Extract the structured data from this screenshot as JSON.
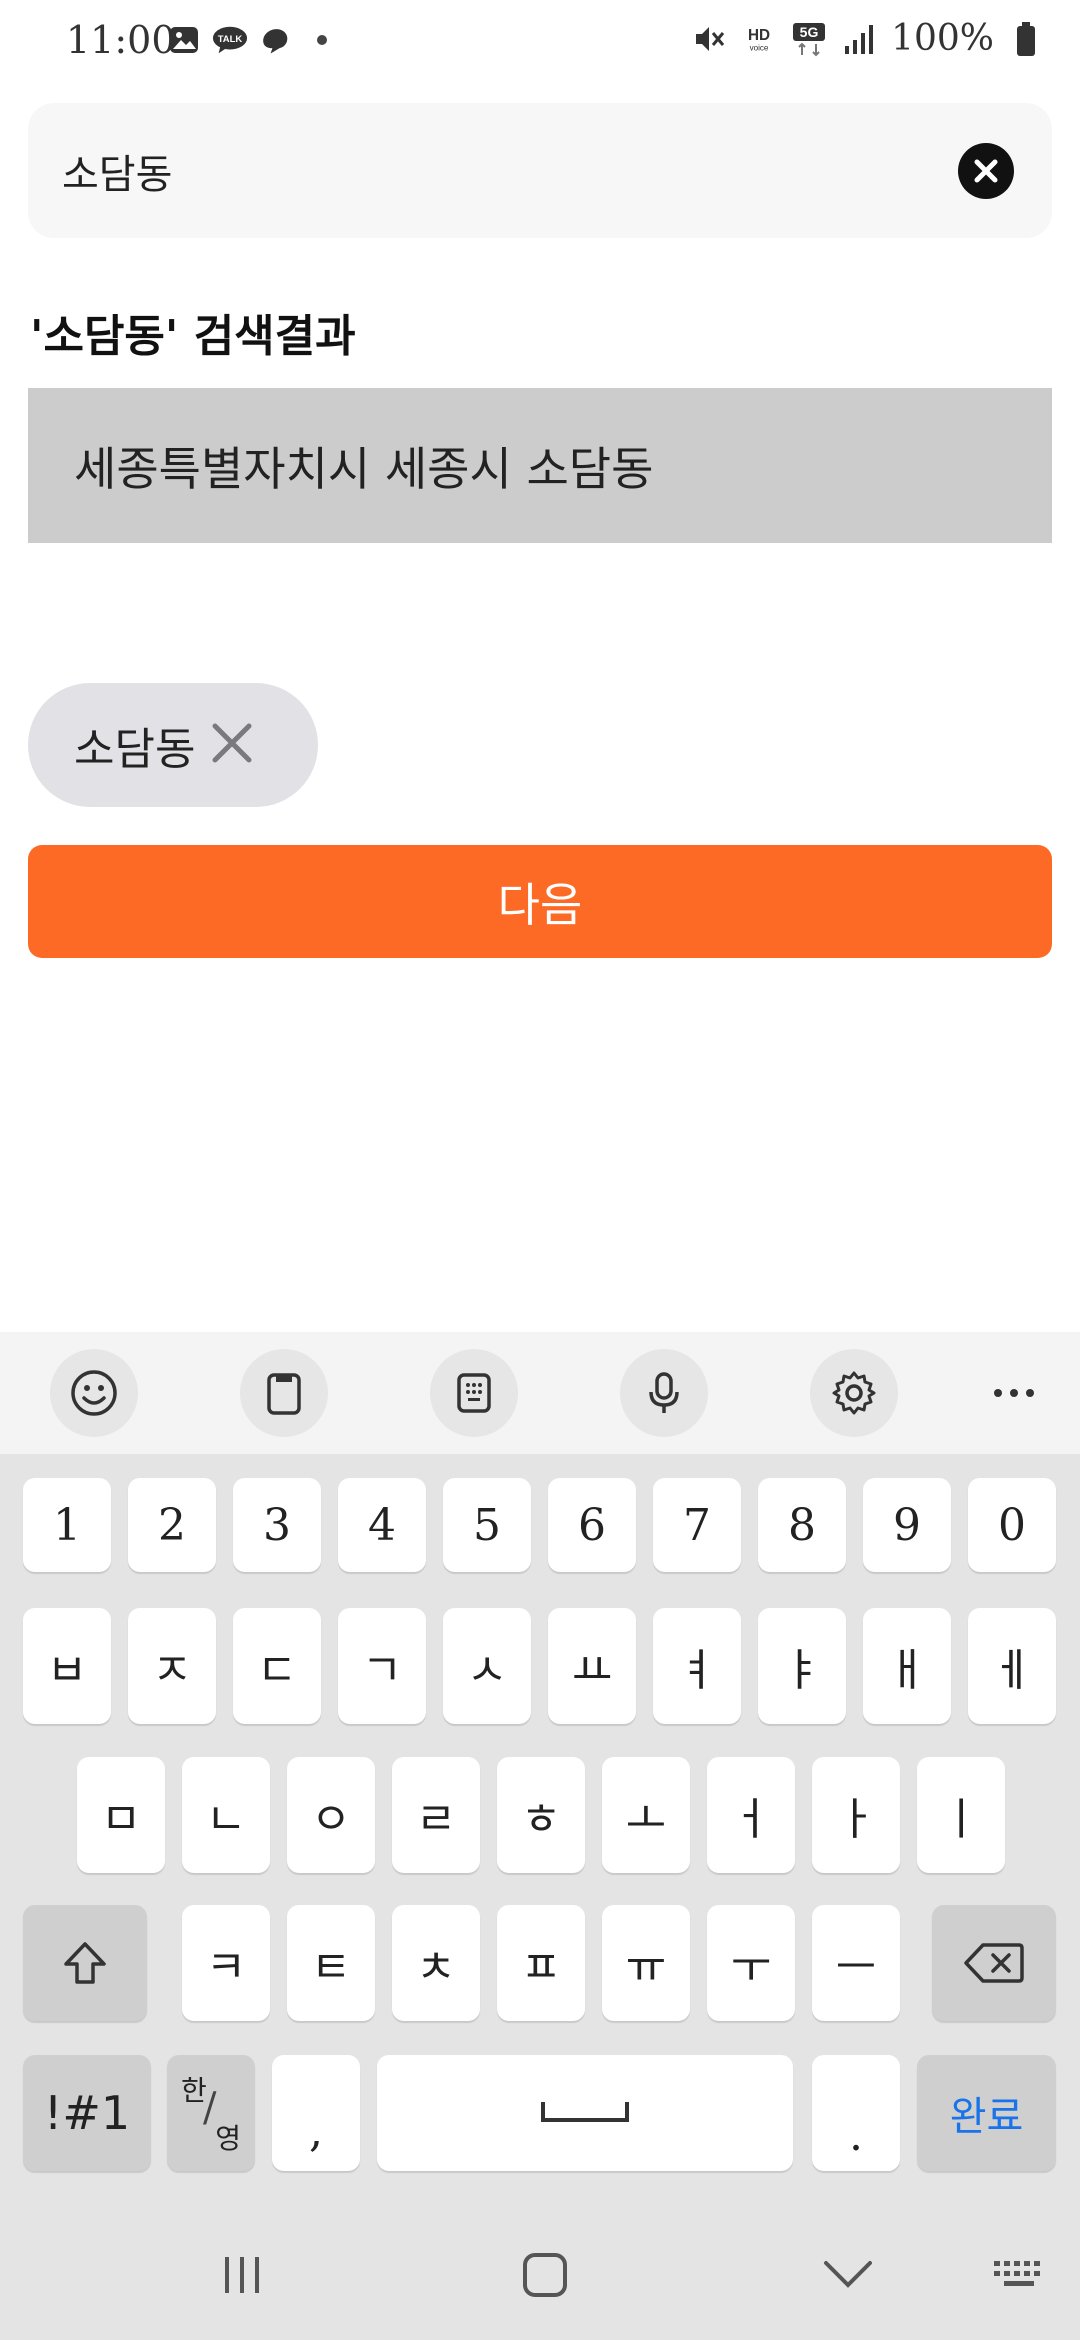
{
  "status_bar": {
    "time": "11:00",
    "left_icons": [
      "gallery-icon",
      "talk-icon",
      "thread-icon",
      "dot-icon"
    ],
    "right_icons": [
      "mute-icon",
      "hd-voice-icon",
      "5g-icon",
      "signal-icon"
    ],
    "battery": "100%"
  },
  "search": {
    "value": "소담동"
  },
  "results": {
    "heading": "'소담동' 검색결과",
    "items": [
      "세종특별자치시 세종시 소담동"
    ]
  },
  "selected_chip": {
    "label": "소담동"
  },
  "next_button": {
    "label": "다음"
  },
  "keyboard": {
    "toolbar": [
      "emoji-icon",
      "clipboard-icon",
      "keypad-icon",
      "mic-icon",
      "settings-icon",
      "more-icon"
    ],
    "number_row": [
      "1",
      "2",
      "3",
      "4",
      "5",
      "6",
      "7",
      "8",
      "9",
      "0"
    ],
    "row1": [
      "ㅂ",
      "ㅈ",
      "ㄷ",
      "ㄱ",
      "ㅅ",
      "ㅛ",
      "ㅕ",
      "ㅑ",
      "ㅐ",
      "ㅔ"
    ],
    "row2": [
      "ㅁ",
      "ㄴ",
      "ㅇ",
      "ㄹ",
      "ㅎ",
      "ㅗ",
      "ㅓ",
      "ㅏ",
      "ㅣ"
    ],
    "row3": [
      "ㅋ",
      "ㅌ",
      "ㅊ",
      "ㅍ",
      "ㅠ",
      "ㅜ",
      "ㅡ"
    ],
    "symbols_label": "!#1",
    "lang_top": "한",
    "lang_bottom": "영",
    "comma": ",",
    "period": ".",
    "done_label": "완료",
    "done_color": "#1a73e8"
  },
  "colors": {
    "accent": "#fd6a25",
    "result_bg": "#cccccc",
    "chip_bg": "#e2e2e6"
  }
}
